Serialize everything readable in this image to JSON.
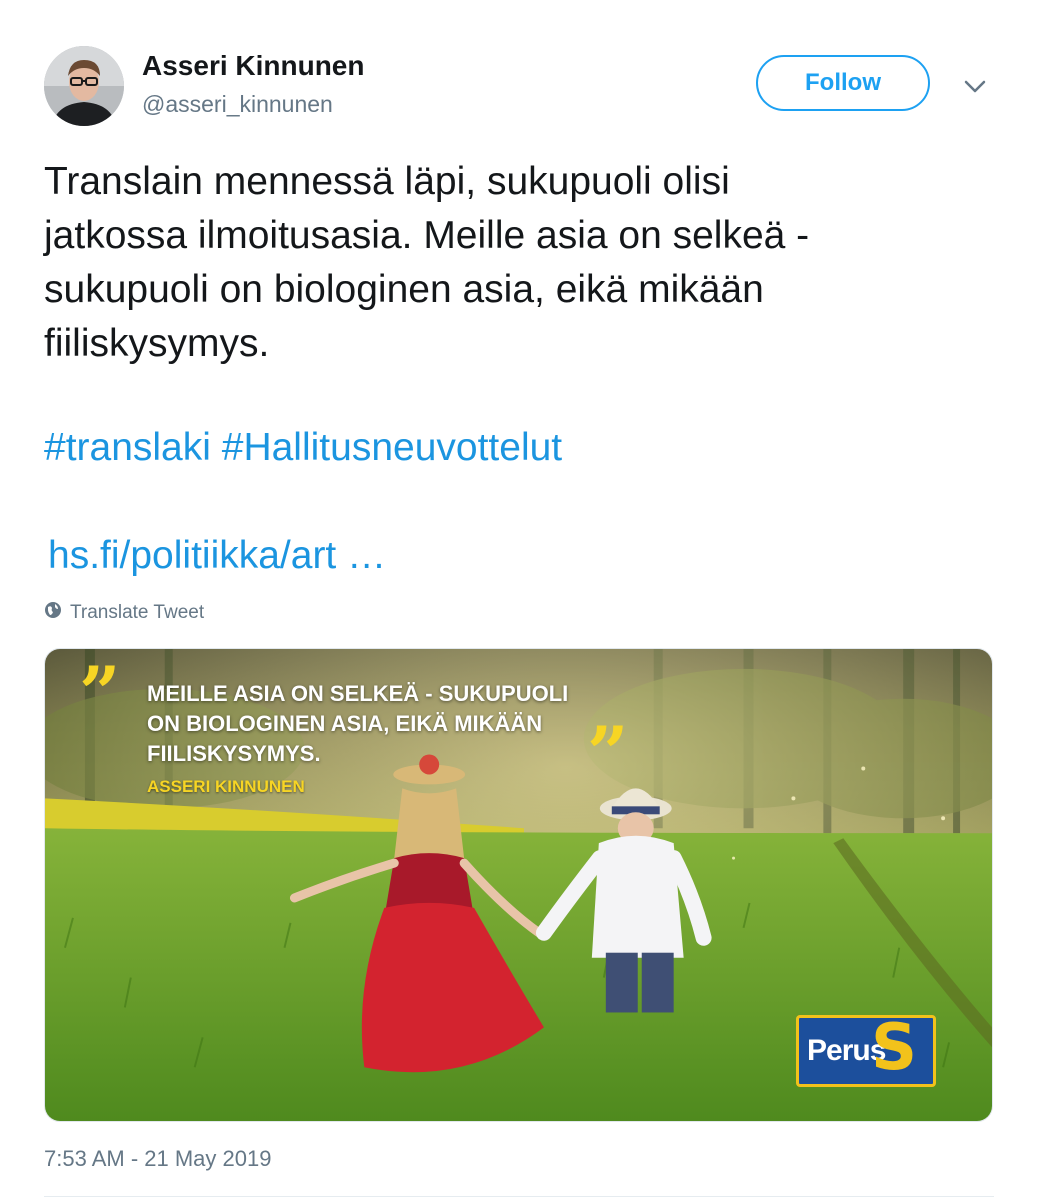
{
  "author": {
    "display_name": "Asseri Kinnunen",
    "handle": "@asseri_kinnunen"
  },
  "actions": {
    "follow_label": "Follow",
    "menu_icon": "chevron-down-icon"
  },
  "tweet": {
    "text_lines": [
      "Translain mennessä läpi, sukupuoli olisi",
      "jatkossa ilmoitusasia. Meille asia on selkeä -",
      "sukupuoli on biologinen asia, eikä mikään",
      "fiiliskysymys."
    ],
    "hashtags": [
      "#translaki",
      "#Hallitusneuvottelut"
    ],
    "link_text": "hs.fi/politiikka/art …",
    "translate_label": "Translate Tweet",
    "translate_icon": "globe-icon",
    "timestamp": "7:53 AM - 21 May 2019"
  },
  "media": {
    "quote_lines": [
      "Meille asia on selkeä - sukupuoli",
      "on biologinen asia, eikä mikään",
      "fiiliskysymys."
    ],
    "quote_author": "Asseri Kinnunen",
    "logo_word": "Perus",
    "logo_letter": "S",
    "colors": {
      "accent_yellow": "#f7d524",
      "logo_blue": "#1c4f9c"
    }
  },
  "colors": {
    "link_blue": "#1b95e0",
    "follow_blue": "#1da1f2",
    "secondary_text": "#657786",
    "primary_text": "#14171a"
  }
}
